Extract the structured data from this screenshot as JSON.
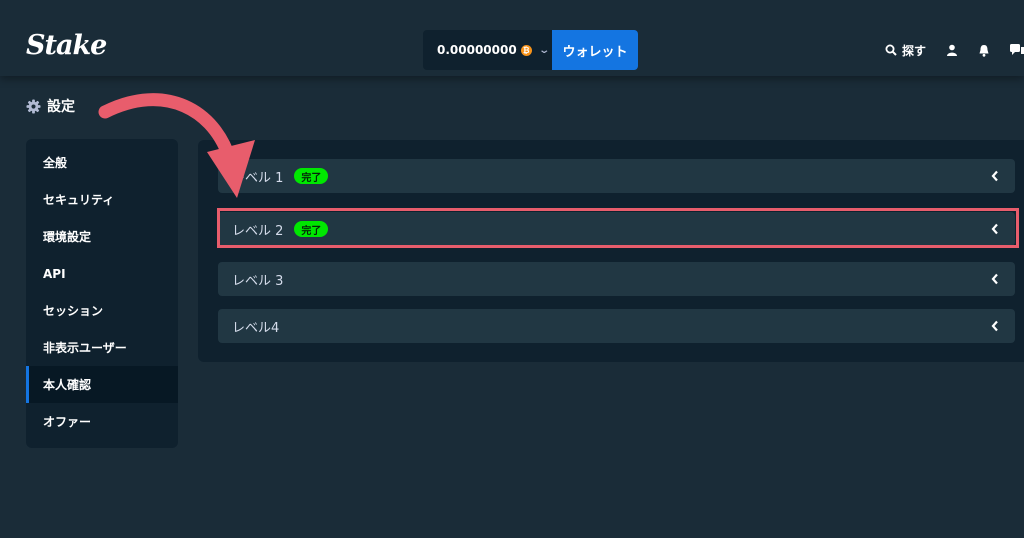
{
  "header": {
    "logo": "Stake",
    "balance": "0.00000000",
    "currency_icon": "bitcoin-icon",
    "wallet_label": "ウォレット",
    "search_label": "探す"
  },
  "settings": {
    "title": "設定"
  },
  "sidebar": {
    "items": [
      {
        "label": "全般",
        "active": false
      },
      {
        "label": "セキュリティ",
        "active": false
      },
      {
        "label": "環境設定",
        "active": false
      },
      {
        "label": "API",
        "active": false
      },
      {
        "label": "セッション",
        "active": false
      },
      {
        "label": "非表示ユーザー",
        "active": false
      },
      {
        "label": "本人確認",
        "active": true
      },
      {
        "label": "オファー",
        "active": false
      }
    ]
  },
  "levels": [
    {
      "label": "レベル 1",
      "badge": "完了"
    },
    {
      "label": "レベル 2",
      "badge": "完了"
    },
    {
      "label": "レベル 3",
      "badge": ""
    },
    {
      "label": "レベル4",
      "badge": ""
    }
  ],
  "colors": {
    "background": "#1a2c38",
    "panel": "#0f212e",
    "row": "#213743",
    "accent": "#1475e1",
    "badge": "#00e701",
    "annotation": "#e85d6c"
  }
}
